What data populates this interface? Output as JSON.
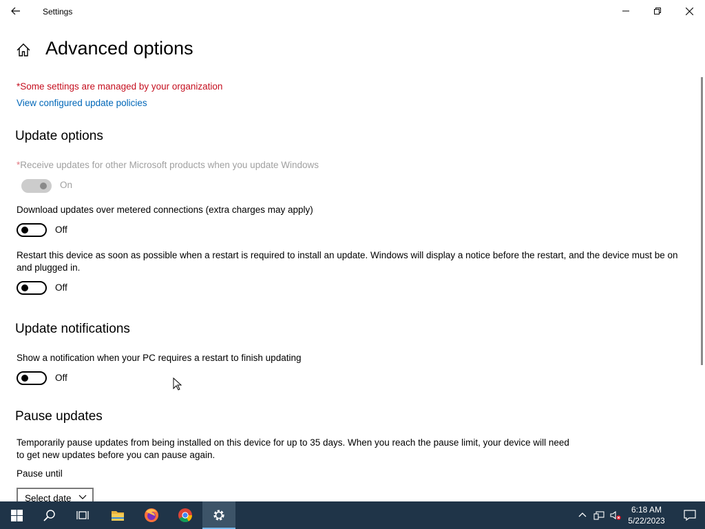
{
  "window": {
    "title": "Settings",
    "minimize_icon": "minimize-icon",
    "maximize_icon": "restore-icon",
    "close_icon": "close-icon"
  },
  "header": {
    "title": "Advanced options",
    "home_icon": "home-icon"
  },
  "org_notice": "*Some settings are managed by your organization",
  "policies_link": "View configured update policies",
  "update_options": {
    "heading": "Update options",
    "items": [
      {
        "asterisk": "*",
        "label": "Receive updates for other Microsoft products when you update Windows",
        "state": "On",
        "enabled": false
      },
      {
        "label": "Download updates over metered connections (extra charges may apply)",
        "state": "Off",
        "enabled": true
      },
      {
        "label": "Restart this device as soon as possible when a restart is required to install an update. Windows will display a notice before the restart, and the device must be on and plugged in.",
        "state": "Off",
        "enabled": true
      }
    ]
  },
  "update_notifications": {
    "heading": "Update notifications",
    "items": [
      {
        "label": "Show a notification when your PC requires a restart to finish updating",
        "state": "Off",
        "enabled": true
      }
    ]
  },
  "pause_updates": {
    "heading": "Pause updates",
    "description": "Temporarily pause updates from being installed on this device for up to 35 days. When you reach the pause limit, your device will need to get new updates before you can pause again.",
    "pause_until_label": "Pause until",
    "select_value": "Select date"
  },
  "taskbar": {
    "items": [
      "start-icon",
      "search-icon",
      "task-view-icon",
      "file-explorer-icon",
      "firefox-icon",
      "chrome-icon",
      "settings-icon"
    ],
    "active": "settings-icon",
    "clock_time": "6:18 AM",
    "clock_date": "5/22/2023"
  },
  "colors": {
    "org_notice": "#c50f1f",
    "link": "#0067b8",
    "taskbar": "#1f3448",
    "taskbar_active": "#3d5468"
  }
}
